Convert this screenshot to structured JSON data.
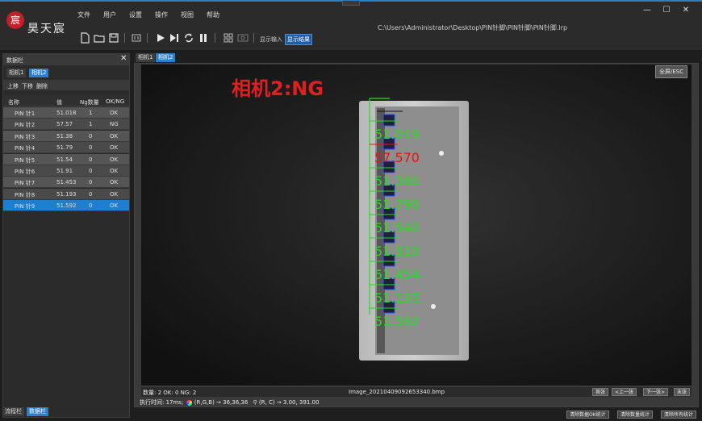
{
  "app": {
    "brand": "昊天宸",
    "logo_glyph": "宸",
    "file_path": "C:\\Users\\Administrator\\Desktop\\PIN针脚\\PIN针脚\\PIN针脚.lrp",
    "menu": [
      "文件",
      "用户",
      "设置",
      "操作",
      "视图",
      "帮助"
    ],
    "show_input_label": "显示输入",
    "show_result_label": "显示结果",
    "window_controls": {
      "minimize": "—",
      "maximize": "☐",
      "close": "✕"
    }
  },
  "toolbar_icons": [
    "new-file-icon",
    "open-folder-icon",
    "save-icon",
    "camera-params-icon",
    "run-icon",
    "step-icon",
    "loop-icon",
    "pause-icon",
    "grid-icon",
    "image-icon"
  ],
  "left_panel": {
    "title": "数据栏",
    "close": "✕",
    "tabs": [
      "相机1",
      "相机2"
    ],
    "active_tab": 1,
    "actions": [
      "上移",
      "下移",
      "删除"
    ],
    "columns": [
      "名称",
      "值",
      "Ng数量",
      "OK/NG"
    ],
    "rows": [
      {
        "name": "PIN 针1",
        "value": "51.018",
        "ng": "1",
        "result": "OK"
      },
      {
        "name": "PIN 针2",
        "value": "57.57",
        "ng": "1",
        "result": "NG"
      },
      {
        "name": "PIN 针3",
        "value": "51.38",
        "ng": "0",
        "result": "OK"
      },
      {
        "name": "PIN 针4",
        "value": "51.79",
        "ng": "0",
        "result": "OK"
      },
      {
        "name": "PIN 针5",
        "value": "51.54",
        "ng": "0",
        "result": "OK"
      },
      {
        "name": "PIN 针6",
        "value": "51.91",
        "ng": "0",
        "result": "OK"
      },
      {
        "name": "PIN 针7",
        "value": "51.453",
        "ng": "0",
        "result": "OK"
      },
      {
        "name": "PIN 针8",
        "value": "51.193",
        "ng": "0",
        "result": "OK"
      },
      {
        "name": "PIN 针9",
        "value": "51.592",
        "ng": "0",
        "result": "OK"
      }
    ],
    "selected_row": 8,
    "bottom_tabs": [
      "流程栏",
      "数据栏"
    ]
  },
  "viewer": {
    "tabs": [
      "相机1",
      "相机2"
    ],
    "active_tab": 1,
    "fullscreen_label": "全屏/ESC",
    "overlay_title": "相机2:NG",
    "overlay_title_color": "#e02020",
    "measurements": [
      {
        "text": "51.019",
        "color": "#22dd22"
      },
      {
        "text": "57.570",
        "color": "#ee1111"
      },
      {
        "text": "51.380",
        "color": "#22dd22"
      },
      {
        "text": "51.790",
        "color": "#22dd22"
      },
      {
        "text": "51.540",
        "color": "#22dd22"
      },
      {
        "text": "51.910",
        "color": "#22dd22"
      },
      {
        "text": "51.454",
        "color": "#22dd22"
      },
      {
        "text": "51.193",
        "color": "#22dd22"
      },
      {
        "text": "51.592",
        "color": "#22dd22"
      }
    ]
  },
  "status": {
    "counts": "数量: 2  OK: 0  NG: 2",
    "image_name": "Image_20210409092653340.bmp",
    "nav": [
      "首张",
      "<上一张",
      "下一张>",
      "末张"
    ],
    "exec_text": "执行时间: 17ms;",
    "rgb_text": "(R,G,B) → 36,36,36",
    "coord_text": "(R, C) → 3.00, 391.00"
  },
  "bottom_buttons": [
    "清除数据OK统计",
    "清除数量统计",
    "清除所有统计"
  ]
}
